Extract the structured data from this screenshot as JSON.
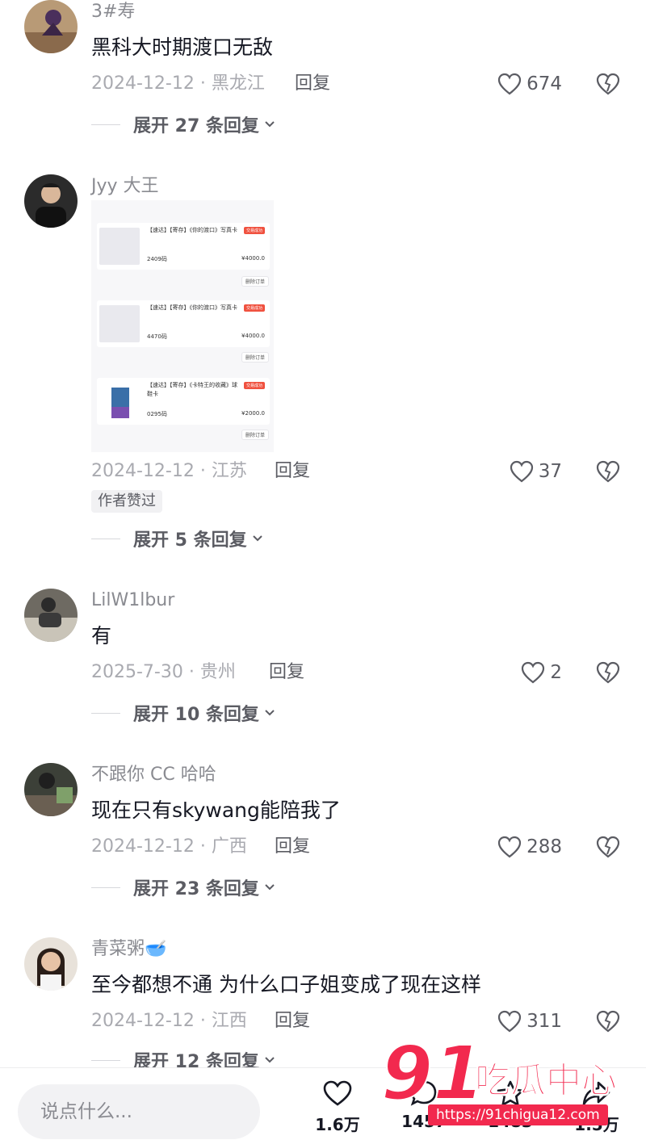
{
  "comments": [
    {
      "username": "3#寿",
      "text": "黑科大时期渡口无敌",
      "meta": "2024-12-12 · 黑龙江",
      "reply_label": "回复",
      "likes": "674",
      "expand_label": "展开 27 条回复"
    },
    {
      "username": "Jyy 大王",
      "meta": "2024-12-12 · 江苏",
      "reply_label": "回复",
      "likes": "37",
      "badge": "作者赞过",
      "expand_label": "展开 5 条回复",
      "image": {
        "orders": [
          {
            "title": "【速达】【寄存】《你的渡口》写真卡",
            "code": "2409码",
            "price": "¥4000.0",
            "tag": "交易成功",
            "delete": "删除订单"
          },
          {
            "title": "【速达】【寄存】《你的渡口》写真卡",
            "code": "4470码",
            "price": "¥4000.0",
            "tag": "交易成功",
            "delete": "删除订单"
          },
          {
            "title": "【速达】【寄存】《卡特王的收藏》球鞋卡",
            "code": "0295码",
            "price": "¥2000.0",
            "tag": "交易成功",
            "delete": "删除订单"
          }
        ]
      }
    },
    {
      "username": "LilW1lbur",
      "text": "有",
      "meta": "2025-7-30 · 贵州",
      "reply_label": "回复",
      "likes": "2",
      "expand_label": "展开 10 条回复"
    },
    {
      "username": "不跟你 CC 哈哈",
      "text": "现在只有skywang能陪我了",
      "meta": "2024-12-12 · 广西",
      "reply_label": "回复",
      "likes": "288",
      "expand_label": "展开 23 条回复"
    },
    {
      "username": "青菜粥🥣",
      "text": "至今都想不通 为什么口子姐变成了现在这样",
      "meta": "2024-12-12 · 江西",
      "reply_label": "回复",
      "likes": "311",
      "expand_label": "展开 12 条回复"
    }
  ],
  "bottom_bar": {
    "input_placeholder": "说点什么...",
    "like_count": "1.6万",
    "comment_count": "1457",
    "favorite_count": "1483",
    "share_count": "1.5万"
  },
  "watermark": {
    "logo_number": "91",
    "logo_text": "吃瓜中心",
    "url": "https://91chigua12.com"
  },
  "colors": {
    "accent": "#f2294e",
    "text_primary": "#161823",
    "text_secondary": "#8a8b91"
  }
}
